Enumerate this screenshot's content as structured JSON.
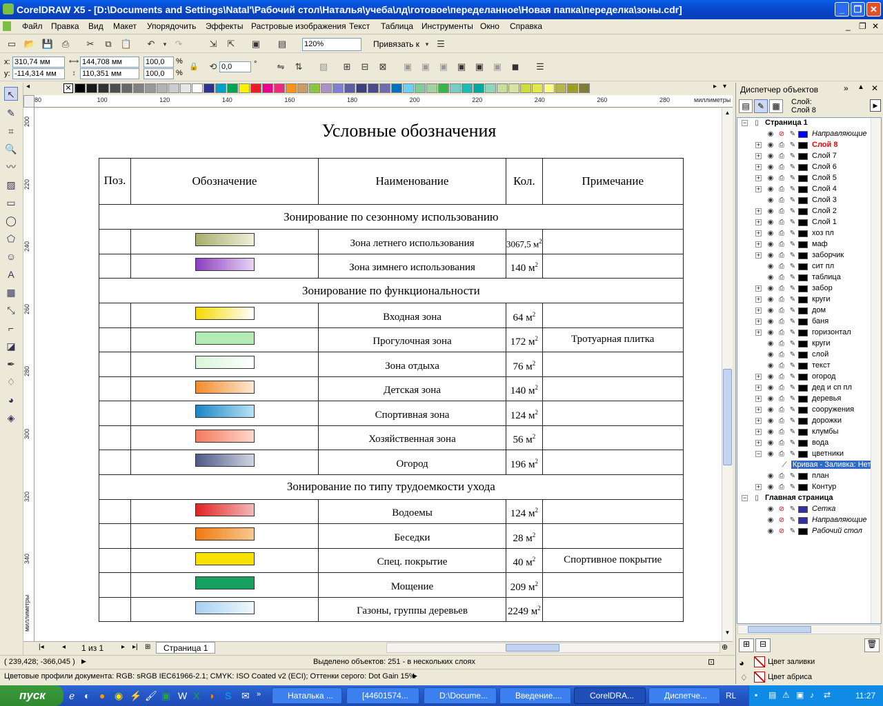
{
  "window": {
    "title": "CorelDRAW X5 - [D:\\Documents and Settings\\Natal'\\Рабочий стол\\Наталья\\учеба\\лд\\готовое\\переделанное\\Новая папка\\переделка\\зоны.cdr]"
  },
  "menu": [
    "Файл",
    "Правка",
    "Вид",
    "Макет",
    "Упорядочить",
    "Эффекты",
    "Растровые изображения",
    "Текст",
    "Таблица",
    "Инструменты",
    "Окно",
    "Справка"
  ],
  "toolbar": {
    "zoom": "120%",
    "snap_label": "Привязать к"
  },
  "props": {
    "x": "310,74 мм",
    "y": "-114,314 мм",
    "w": "144,708 мм",
    "h": "110,351 мм",
    "sx": "100,0",
    "sy": "100,0",
    "pct": "%",
    "angle": "0,0",
    "deg": "°"
  },
  "ruler": {
    "units": "миллиметры",
    "h_ticks": [
      "80",
      "100",
      "120",
      "140",
      "160",
      "180",
      "200",
      "220",
      "240",
      "260",
      "280"
    ],
    "v_ticks": [
      "200",
      "220",
      "240",
      "260",
      "280",
      "300",
      "320",
      "340"
    ]
  },
  "palette_colors": [
    "#000000",
    "#1a1a1a",
    "#333333",
    "#4d4d4d",
    "#666666",
    "#808080",
    "#999999",
    "#b3b3b3",
    "#cccccc",
    "#e6e6e6",
    "#ffffff",
    "#2e3192",
    "#00a0c6",
    "#00a651",
    "#fff200",
    "#ed1c24",
    "#ec008c",
    "#ee2a7b",
    "#f7941d",
    "#c69c6d",
    "#8dc63f",
    "#ab91c5",
    "#7f7fd5",
    "#5b5ea6",
    "#3c3f80",
    "#4a4a8a",
    "#6d6dab",
    "#0072bc",
    "#6dcff6",
    "#82ca9c",
    "#a2d39c",
    "#39b54a",
    "#7accc8",
    "#1cbbb4",
    "#00a99d",
    "#8fd6bd",
    "#c4df9b",
    "#d7e3a1",
    "#cddc39",
    "#e2e84b",
    "#fbf98a",
    "#b5b54d",
    "#9e9d24",
    "#7d7d3a"
  ],
  "page": {
    "heading": "Условные обозначения"
  },
  "legend": {
    "headers": [
      "Поз.",
      "Обозначение",
      "Наименование",
      "Кол.",
      "Примечание"
    ],
    "sections": [
      {
        "title": "Зонирование по сезонному использованию",
        "rows": [
          {
            "name": "Зона летнего использования",
            "qty": "3067,5 м",
            "note": "",
            "c1": "#a9ad6e",
            "c2": "#eef0d8"
          },
          {
            "name": "Зона зимнего использования",
            "qty": "140 м",
            "note": "",
            "c1": "#8c3fc0",
            "c2": "#e8d4f4"
          }
        ]
      },
      {
        "title": "Зонирование по функциональности",
        "rows": [
          {
            "name": "Входная зона",
            "qty": "64 м",
            "note": "",
            "c1": "#f6d900",
            "c2": "#ffffff"
          },
          {
            "name": "Прогулочная зона",
            "qty": "172 м",
            "note": "Тротуарная плитка",
            "c1": "#b4eab4",
            "c2": "#b4eab4"
          },
          {
            "name": "Зона отдыха",
            "qty": "76 м",
            "note": "",
            "c1": "#d9f5d9",
            "c2": "#ffffff"
          },
          {
            "name": "Детская зона",
            "qty": "140 м",
            "note": "",
            "c1": "#f28b2b",
            "c2": "#fde8d2"
          },
          {
            "name": "Спортивная зона",
            "qty": "124 м",
            "note": "",
            "c1": "#1a86c8",
            "c2": "#b8e2f4"
          },
          {
            "name": "Хозяйственная зона",
            "qty": "56 м",
            "note": "",
            "c1": "#f47a5c",
            "c2": "#fdd8cc"
          },
          {
            "name": "Огород",
            "qty": "196 м",
            "note": "",
            "c1": "#4f5a85",
            "c2": "#d0d4e4"
          }
        ]
      },
      {
        "title": "Зонирование по типу трудоемкости ухода",
        "rows": [
          {
            "name": "Водоемы",
            "qty": "124 м",
            "note": "",
            "c1": "#e02424",
            "c2": "#f4b8b8"
          },
          {
            "name": "Беседки",
            "qty": "28 м",
            "note": "",
            "c1": "#f07a10",
            "c2": "#f8c890"
          },
          {
            "name": "Спец. покрытие",
            "qty": "40 м",
            "note": "Спортивное покрытие",
            "c1": "#f8e000",
            "c2": "#f8e000"
          },
          {
            "name": "Мощение",
            "qty": "209 м",
            "note": "",
            "c1": "#16a060",
            "c2": "#16a060"
          },
          {
            "name": "Газоны, группы деревьев",
            "qty": "2249 м",
            "note": "",
            "c1": "#a8d0f0",
            "c2": "#f0f8fc"
          }
        ]
      }
    ],
    "sup": "2"
  },
  "pages": {
    "counter": "1 из 1",
    "tab": "Страница 1"
  },
  "status": {
    "coords": "( 239,428; -366,045 )",
    "selection": "Выделено объектов: 251 - в нескольких слоях",
    "profiles": "Цветовые профили документа: RGB: sRGB IEC61966-2.1; CMYK: ISO Coated v2 (ECI); Оттенки серого: Dot Gain 15%"
  },
  "docker": {
    "title": "Диспетчер объектов",
    "layer_label": "Слой:",
    "layer_value": "Слой 8",
    "fill_label": "Цвет заливки",
    "outline_label": "Цвет абриса",
    "tree": [
      {
        "name": "Страница 1",
        "level": 0,
        "exp": "−",
        "bold": true
      },
      {
        "name": "Направляющие",
        "level": 1,
        "exp": "",
        "italic": true,
        "color": "#0000ff"
      },
      {
        "name": "Слой 8",
        "level": 1,
        "exp": "+",
        "red": true,
        "color": "#000000"
      },
      {
        "name": "Слой 7",
        "level": 1,
        "exp": "+",
        "color": "#000000"
      },
      {
        "name": "Слой 6",
        "level": 1,
        "exp": "+",
        "color": "#000000"
      },
      {
        "name": "Слой 5",
        "level": 1,
        "exp": "+",
        "color": "#000000"
      },
      {
        "name": "Слой 4",
        "level": 1,
        "exp": "+",
        "color": "#000000"
      },
      {
        "name": "Слой 3",
        "level": 1,
        "exp": "",
        "color": "#000000"
      },
      {
        "name": "Слой 2",
        "level": 1,
        "exp": "+",
        "color": "#000000"
      },
      {
        "name": "Слой 1",
        "level": 1,
        "exp": "+",
        "color": "#000000"
      },
      {
        "name": "хоз пл",
        "level": 1,
        "exp": "+",
        "color": "#000000"
      },
      {
        "name": "маф",
        "level": 1,
        "exp": "+",
        "color": "#000000"
      },
      {
        "name": "заборчик",
        "level": 1,
        "exp": "+",
        "color": "#000000"
      },
      {
        "name": "сит пл",
        "level": 1,
        "exp": "",
        "color": "#000000"
      },
      {
        "name": "таблица",
        "level": 1,
        "exp": "",
        "color": "#000000"
      },
      {
        "name": "забор",
        "level": 1,
        "exp": "+",
        "color": "#000000"
      },
      {
        "name": "круги",
        "level": 1,
        "exp": "+",
        "color": "#000000"
      },
      {
        "name": "дом",
        "level": 1,
        "exp": "+",
        "color": "#000000"
      },
      {
        "name": "баня",
        "level": 1,
        "exp": "+",
        "color": "#000000"
      },
      {
        "name": "горизонтал",
        "level": 1,
        "exp": "+",
        "color": "#000000"
      },
      {
        "name": "круги",
        "level": 1,
        "exp": "",
        "color": "#000000"
      },
      {
        "name": "слой",
        "level": 1,
        "exp": "",
        "color": "#000000"
      },
      {
        "name": "текст",
        "level": 1,
        "exp": "",
        "color": "#000000"
      },
      {
        "name": "огород",
        "level": 1,
        "exp": "+",
        "color": "#000000"
      },
      {
        "name": "дед и сп пл",
        "level": 1,
        "exp": "+",
        "color": "#000000"
      },
      {
        "name": "деревья",
        "level": 1,
        "exp": "+",
        "color": "#000000"
      },
      {
        "name": "сооружения",
        "level": 1,
        "exp": "+",
        "color": "#000000"
      },
      {
        "name": "дорожки",
        "level": 1,
        "exp": "+",
        "color": "#000000"
      },
      {
        "name": "клумбы",
        "level": 1,
        "exp": "+",
        "color": "#000000"
      },
      {
        "name": "вода",
        "level": 1,
        "exp": "+",
        "color": "#000000"
      },
      {
        "name": "цветники",
        "level": 1,
        "exp": "−",
        "color": "#000000"
      },
      {
        "name": "Кривая - Заливка: Нет, А",
        "level": 2,
        "exp": "",
        "selected": true
      },
      {
        "name": "план",
        "level": 1,
        "exp": "",
        "color": "#000000"
      },
      {
        "name": "Контур",
        "level": 1,
        "exp": "+",
        "color": "#000000"
      },
      {
        "name": "Главная страница",
        "level": 0,
        "exp": "−",
        "bold": true
      },
      {
        "name": "Сетка",
        "level": 1,
        "exp": "",
        "italic": true,
        "color": "#3030a0"
      },
      {
        "name": "Направляющие",
        "level": 1,
        "exp": "",
        "italic": true,
        "color": "#3030a0"
      },
      {
        "name": "Рабочий стол",
        "level": 1,
        "exp": "",
        "italic": true,
        "color": "#000000"
      }
    ]
  },
  "taskbar": {
    "start": "пуск",
    "tasks": [
      "Наталька ...",
      "[44601574...",
      "D:\\Docume...",
      "Введение....",
      "CorelDRA...",
      "Диспетче..."
    ],
    "lang": "RL",
    "clock": "11:27"
  }
}
